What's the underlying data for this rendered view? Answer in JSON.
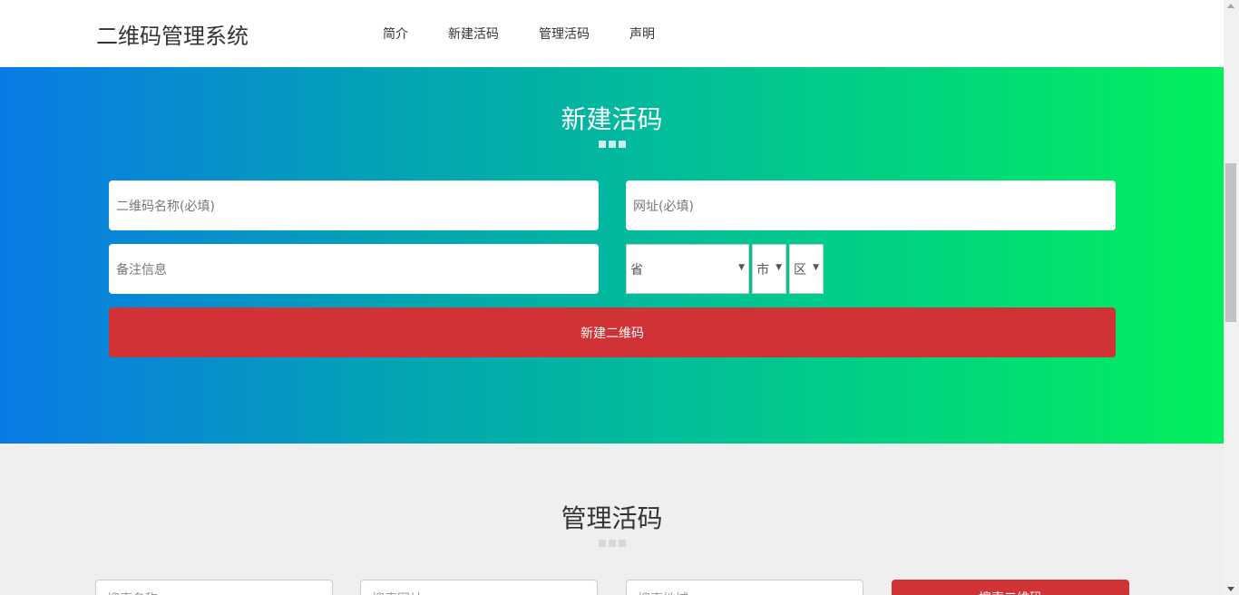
{
  "header": {
    "brand": "二维码管理系统",
    "nav": [
      "简介",
      "新建活码",
      "管理活码",
      "声明"
    ]
  },
  "create": {
    "title": "新建活码",
    "name_placeholder": "二维码名称(必填)",
    "url_placeholder": "网址(必填)",
    "note_placeholder": "备注信息",
    "province": "省",
    "city": "市",
    "district": "区",
    "submit_label": "新建二维码"
  },
  "manage": {
    "title": "管理活码",
    "search_name": "搜索名称",
    "search_url": "搜索网址",
    "search_region": "搜索地域",
    "search_button": "搜索二维码"
  },
  "colors": {
    "gradient_start": "#0a7ae6",
    "gradient_end": "#02ef5c",
    "accent_red": "#d03235"
  }
}
